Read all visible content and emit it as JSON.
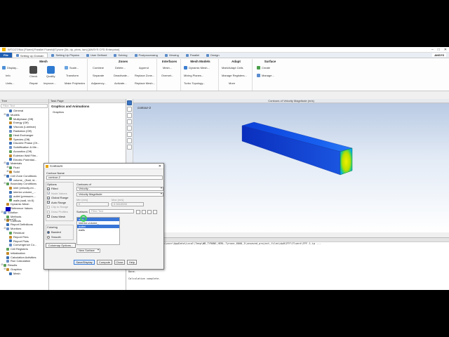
{
  "window": {
    "title": "WTCOT/fluo [Fluent] Parallel Fluent@Tyrone [3d, dp, pbns, lam] [ANSYS CFD Enterprise]",
    "controls": [
      "–",
      "□",
      "✕"
    ]
  },
  "tabs": [
    "File",
    "Setting Up Domain",
    "Setting Up Physics",
    "User Defined",
    "Solving",
    "Postprocessing",
    "Viewing",
    "Parallel",
    "Design"
  ],
  "active_tab": "Setting Up Domain",
  "brand": "ANSYS",
  "ribbon": {
    "mesh": {
      "title": "Mesh",
      "display": "Display...",
      "info": "Info",
      "units": "Units...",
      "check": "Check",
      "repair": "Repair",
      "quality": "Quality",
      "improve": "Improve...",
      "scale": "Scale...",
      "transform": "Transform",
      "polyhedra": "Make Polyhedra"
    },
    "zones": {
      "title": "Zones",
      "combine": "Combine",
      "separate": "Separate",
      "adjacency": "Adjacency...",
      "delete": "Delete...",
      "deactivate": "Deactivate...",
      "activate": "Activate...",
      "append": "Append",
      "replace_zone": "Replace Zone...",
      "replace_mesh": "Replace Mesh..."
    },
    "interfaces": {
      "title": "Interfaces",
      "mesh": "Mesh...",
      "overset": "Overset..."
    },
    "mesh_models": {
      "title": "Mesh Models",
      "dynamic": "Dynamic Mesh...",
      "mixing": "Mixing Planes...",
      "turbo": "Turbo Topology..."
    },
    "adapt": {
      "title": "Adapt",
      "mark": "Mark/Adapt Cells",
      "manage": "Manage Registers...",
      "more": "More"
    },
    "surface": {
      "title": "Surface",
      "create": "Create",
      "manage": "Manage..."
    }
  },
  "tree": {
    "header": "Tree",
    "filter_placeholder": "Filter Text",
    "items": [
      {
        "label": "General",
        "level": 2,
        "expander": ""
      },
      {
        "label": "Models",
        "level": 1,
        "expander": "⊟"
      },
      {
        "label": "Multiphase (Off)",
        "level": 2,
        "expander": ""
      },
      {
        "label": "Energy (Off)",
        "level": 2,
        "expander": ""
      },
      {
        "label": "Viscous (Laminar)",
        "level": 2,
        "expander": ""
      },
      {
        "label": "Radiation (Off)",
        "level": 2,
        "expander": ""
      },
      {
        "label": "Heat Exchanger",
        "level": 2,
        "expander": ""
      },
      {
        "label": "Species (Off)",
        "level": 2,
        "expander": ""
      },
      {
        "label": "Discrete Phase (Of...",
        "level": 2,
        "expander": ""
      },
      {
        "label": "Solidification & Me...",
        "level": 2,
        "expander": ""
      },
      {
        "label": "Acoustics (Off)",
        "level": 2,
        "expander": ""
      },
      {
        "label": "Eulerian Wall Film...",
        "level": 2,
        "expander": ""
      },
      {
        "label": "Electric Potential...",
        "level": 2,
        "expander": ""
      },
      {
        "label": "Materials",
        "level": 1,
        "expander": "⊟"
      },
      {
        "label": "Fluid",
        "level": 2,
        "expander": "⊞"
      },
      {
        "label": "Solid",
        "level": 2,
        "expander": "⊞"
      },
      {
        "label": "Cell Zone Conditions",
        "level": 1,
        "expander": "⊟"
      },
      {
        "label": "volume_ (fluid, id...",
        "level": 2,
        "expander": ""
      },
      {
        "label": "Boundary Conditions",
        "level": 1,
        "expander": "⊟"
      },
      {
        "label": "inlet (velocity-inl...",
        "level": 2,
        "expander": ""
      },
      {
        "label": "interior-volume_...",
        "level": 2,
        "expander": ""
      },
      {
        "label": "outlet (pressure-...",
        "level": 2,
        "expander": ""
      },
      {
        "label": "walls (wall, id=5)",
        "level": 2,
        "expander": ""
      },
      {
        "label": "Dynamic Mesh",
        "level": 1,
        "expander": ""
      },
      {
        "label": "Reference Values",
        "level": 1,
        "expander": ""
      },
      {
        "label": "Solution",
        "level": 0,
        "expander": "⊟"
      },
      {
        "label": "Methods",
        "level": 1,
        "expander": ""
      },
      {
        "label": "Controls",
        "level": 1,
        "expander": ""
      },
      {
        "label": "Report Definitions",
        "level": 1,
        "expander": ""
      },
      {
        "label": "Monitors",
        "level": 1,
        "expander": "⊟"
      },
      {
        "label": "Residual",
        "level": 2,
        "expander": ""
      },
      {
        "label": "Report Files",
        "level": 2,
        "expander": ""
      },
      {
        "label": "Report Plots",
        "level": 2,
        "expander": ""
      },
      {
        "label": "Convergence Co...",
        "level": 2,
        "expander": ""
      },
      {
        "label": "Cell Registers",
        "level": 1,
        "expander": ""
      },
      {
        "label": "Initialization",
        "level": 1,
        "expander": ""
      },
      {
        "label": "Calculation Activities",
        "level": 1,
        "expander": ""
      },
      {
        "label": "Run Calculation",
        "level": 1,
        "expander": ""
      },
      {
        "label": "Results",
        "level": 0,
        "expander": "⊟"
      },
      {
        "label": "Graphics",
        "level": 1,
        "expander": "⊟"
      },
      {
        "label": "Mesh",
        "level": 2,
        "expander": ""
      }
    ]
  },
  "task_page": {
    "header": "Task Page",
    "title": "Graphics and Animations",
    "items": [
      "Graphics"
    ],
    "help_label": "Help"
  },
  "viewport": {
    "header": "Contours of Velocity Magnitude (m/s)",
    "scene_label": "contour-2",
    "legend_value": "0.00e+00"
  },
  "console": {
    "header": "Console",
    "lines": [
      "Writing data to C:\\Users\\user\\AppData\\Local\\Temp\\WB_TYRONE_HERL-Tyrone_6000_3\\unsaved_project_files\\dp0\\FFF\\Fluent\\FFF-1.ip ...",
      "        x-coord",
      "        y-coord",
      "        z-coord",
      "        pressure",
      "        x-velocity",
      "        y-velocity",
      "        z-velocity",
      "Done.",
      "",
      "Calculation complete."
    ]
  },
  "dialog": {
    "title": "Contours",
    "contour_name_label": "Contour Name",
    "contour_name_value": "contour-2",
    "options_label": "Options",
    "options": [
      {
        "label": "Filled",
        "checked": true,
        "disabled": false
      },
      {
        "label": "Node Values",
        "checked": true,
        "disabled": true
      },
      {
        "label": "Global Range",
        "checked": true,
        "disabled": false
      },
      {
        "label": "Auto Range",
        "checked": true,
        "disabled": false
      },
      {
        "label": "Clip to Range",
        "checked": false,
        "disabled": true
      },
      {
        "label": "Draw Profiles",
        "checked": false,
        "disabled": true
      },
      {
        "label": "Draw Mesh",
        "checked": false,
        "disabled": false
      }
    ],
    "coloring_label": "Coloring",
    "coloring_options": [
      {
        "label": "Banded",
        "selected": true
      },
      {
        "label": "Smooth",
        "selected": false
      }
    ],
    "colormap_button": "Colormap Options...",
    "contours_of_label": "Contours of",
    "contours_of_value": "Velocity...",
    "contours_sub_value": "Velocity Magnitude",
    "min_label": "Min [m/s]",
    "max_label": "Max [m/s]",
    "min_value": "0",
    "max_value": "0.9410533",
    "surfaces_label": "Surfaces",
    "surfaces_filter_placeholder": "Filter Text",
    "surfaces": [
      {
        "name": "inlet",
        "selected": true
      },
      {
        "name": "interior-volume_",
        "selected": false
      },
      {
        "name": "outlet",
        "selected": true
      },
      {
        "name": "walls",
        "selected": false
      }
    ],
    "new_surface_label": "New Surface",
    "buttons": {
      "save_display": "Save/Display",
      "compute": "Compute",
      "close": "Close",
      "help": "Help"
    }
  },
  "colors": {
    "accent": "#1e5fb4",
    "selection": "#3875d7",
    "legend_blue": "#0000b8",
    "cursor": "#3ccf5a"
  }
}
